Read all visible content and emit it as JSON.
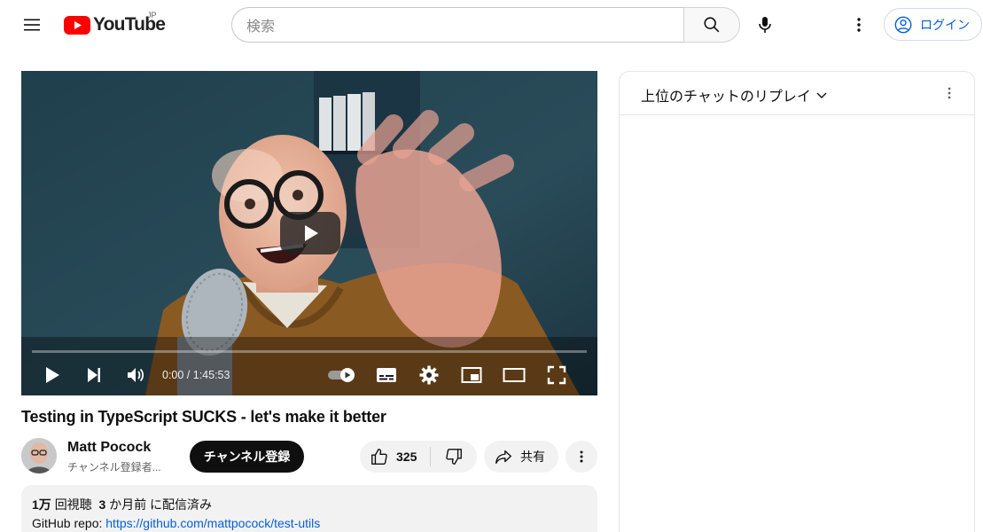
{
  "header": {
    "logo_text": "YouTube",
    "region": "JP",
    "search_placeholder": "検索",
    "login_label": "ログイン"
  },
  "player": {
    "time_display": "0:00 / 1:45:53",
    "progress": 0
  },
  "video": {
    "title": "Testing in TypeScript SUCKS - let's make it better",
    "channel_name": "Matt Pocock",
    "subscriber_text": "チャンネル登録者...",
    "subscribe_label": "チャンネル登録",
    "like_count": "325",
    "share_label": "共有"
  },
  "description": {
    "views": "1万",
    "views_suffix": "回視聴",
    "age": "3",
    "age_suffix": "か月前 に配信済み",
    "repo_prefix": "GitHub repo: ",
    "repo_link": "https://github.com/mattpocock/test-utils"
  },
  "chat": {
    "title": "上位のチャットのリプレイ"
  },
  "colors": {
    "brand_red": "#ff0000",
    "link_blue": "#065fd4"
  },
  "icons": [
    "menu-icon",
    "youtube-logo-icon",
    "search-icon",
    "mic-icon",
    "more-vert-icon",
    "account-icon",
    "play-icon",
    "next-icon",
    "volume-icon",
    "autoplay-toggle-icon",
    "subtitles-icon",
    "settings-icon",
    "miniplayer-icon",
    "theater-icon",
    "fullscreen-icon",
    "thumb-up-icon",
    "thumb-down-icon",
    "share-icon",
    "chevron-down-icon"
  ]
}
